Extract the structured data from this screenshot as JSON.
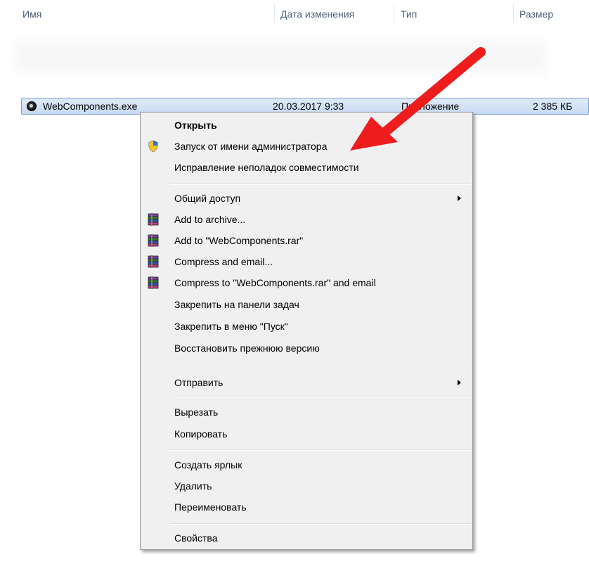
{
  "columns": {
    "name": "Имя",
    "date": "Дата изменения",
    "type": "Тип",
    "size": "Размер"
  },
  "file": {
    "name": "WebComponents.exe",
    "date": "20.03.2017 9:33",
    "type": "Приложение",
    "size": "2 385 КБ",
    "icon": "exe-app-icon"
  },
  "menu": {
    "open": "Открыть",
    "run_as_admin": "Запуск от имени администратора",
    "compat": "Исправление неполадок совместимости",
    "share": "Общий доступ",
    "add_archive": "Add to archive...",
    "add_rar": "Add to \"WebComponents.rar\"",
    "compress_email": "Compress and email...",
    "compress_rar_email": "Compress to \"WebComponents.rar\" and email",
    "pin_taskbar": "Закрепить на панели задач",
    "pin_start": "Закрепить в меню \"Пуск\"",
    "restore": "Восстановить прежнюю версию",
    "send_to": "Отправить",
    "cut": "Вырезать",
    "copy": "Копировать",
    "shortcut": "Создать ярлык",
    "delete": "Удалить",
    "rename": "Переименовать",
    "properties": "Свойства"
  },
  "colors": {
    "selection": "#cddcf0",
    "annotation_arrow": "#ee1c1c",
    "menu_bg": "#f0f0f0"
  }
}
